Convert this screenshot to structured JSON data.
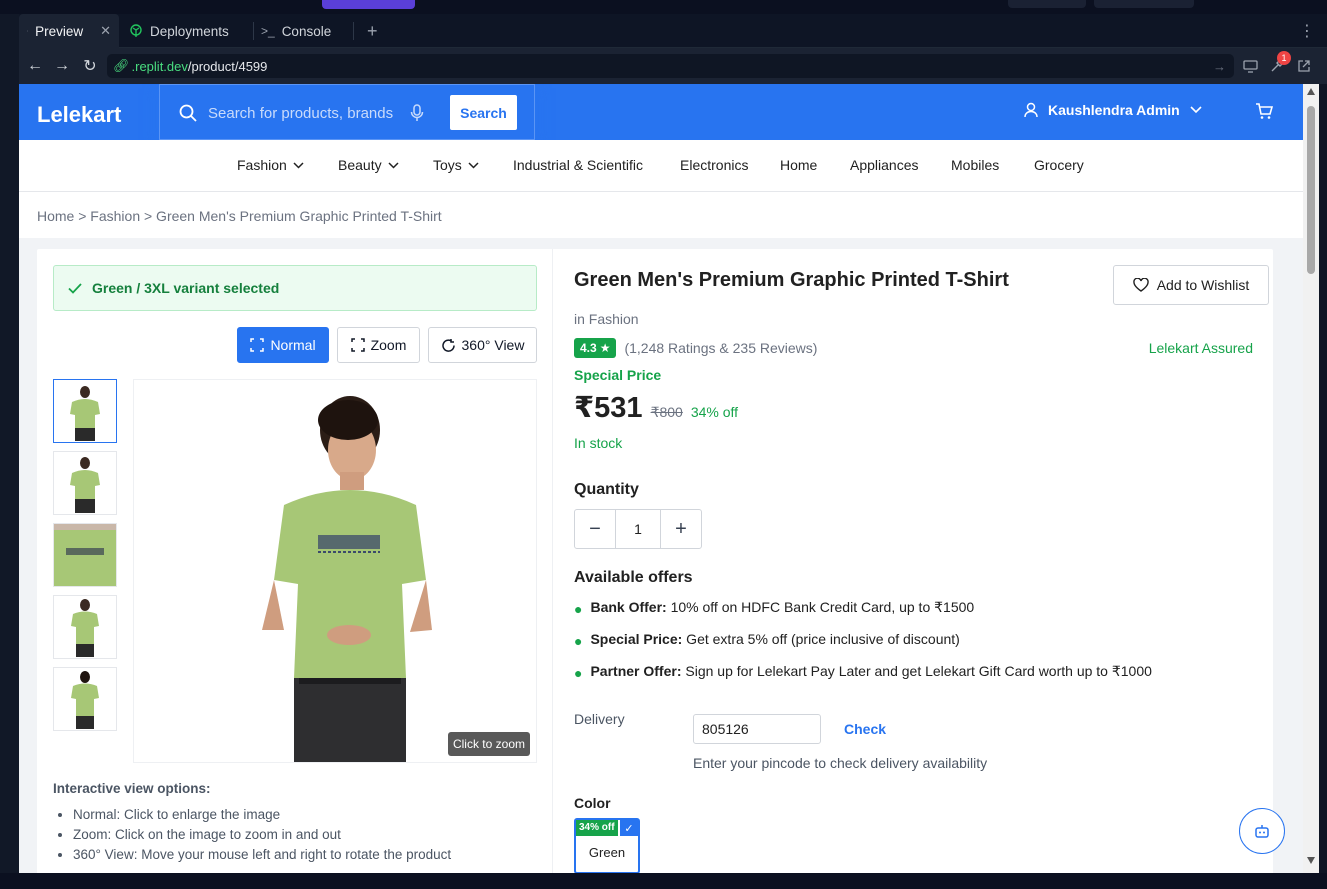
{
  "ide": {
    "tabs": [
      {
        "label": "Preview",
        "icon": "monitor-icon",
        "active": true
      },
      {
        "label": "Deployments",
        "icon": "deploy-icon",
        "active": false
      },
      {
        "label": "Console",
        "icon": "terminal-icon",
        "active": false
      }
    ],
    "url_host": ".replit.dev",
    "url_path": "/product/4599",
    "notification_count": "1"
  },
  "site": {
    "logo": "Lelekart",
    "search": {
      "placeholder": "Search for products, brands and more",
      "button": "Search"
    },
    "user_name": "Kaushlendra Admin",
    "categories": [
      {
        "label": "Fashion",
        "dropdown": true
      },
      {
        "label": "Beauty",
        "dropdown": true
      },
      {
        "label": "Toys",
        "dropdown": true
      },
      {
        "label": "Industrial & Scientific",
        "dropdown": false
      },
      {
        "label": "Electronics",
        "dropdown": false
      },
      {
        "label": "Home",
        "dropdown": false
      },
      {
        "label": "Appliances",
        "dropdown": false
      },
      {
        "label": "Mobiles",
        "dropdown": false
      },
      {
        "label": "Grocery",
        "dropdown": false
      }
    ],
    "breadcrumb": "Home > Fashion > Green Men's Premium Graphic Printed T-Shirt"
  },
  "gallery": {
    "variant_selected": "Green / 3XL variant selected",
    "view_buttons": {
      "normal": "Normal",
      "zoom": "Zoom",
      "view360": "360° View"
    },
    "zoom_hint": "Click to zoom",
    "help_title": "Interactive view options:",
    "help_items": [
      "Normal: Click to enlarge the image",
      "Zoom: Click on the image to zoom in and out",
      "360° View: Move your mouse left and right to rotate the product"
    ],
    "shirt_color": "#a7c776"
  },
  "product": {
    "title": "Green Men's Premium Graphic Printed T-Shirt",
    "wishlist": "Add to Wishlist",
    "category": "in Fashion",
    "rating": "4.3",
    "ratings_text": "(1,248 Ratings & 235 Reviews)",
    "assured": "Lelekart Assured",
    "special_price_label": "Special Price",
    "price": "₹531",
    "mrp": "₹800",
    "discount": "34% off",
    "stock": "In stock",
    "quantity_label": "Quantity",
    "quantity": "1",
    "offers_title": "Available offers",
    "offers": [
      {
        "title": "Bank Offer:",
        "text": " 10% off on HDFC Bank Credit Card, up to ₹1500"
      },
      {
        "title": "Special Price:",
        "text": " Get extra 5% off (price inclusive of discount)"
      },
      {
        "title": "Partner Offer:",
        "text": " Sign up for Lelekart Pay Later and get Lelekart Gift Card worth up to ₹1000"
      }
    ],
    "delivery_label": "Delivery",
    "pincode": "805126",
    "check": "Check",
    "pincode_hint": "Enter your pincode to check delivery availability",
    "color_label": "Color",
    "color_badge": "34% off",
    "color_name": "Green"
  },
  "colors": {
    "brand": "#2874f0",
    "success": "#16a34a"
  }
}
